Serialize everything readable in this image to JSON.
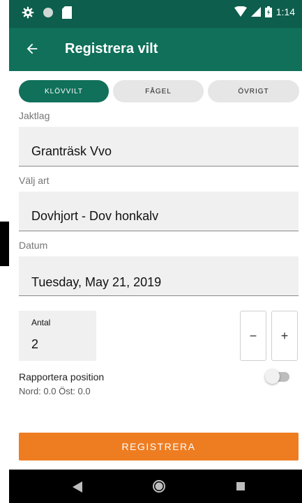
{
  "status_bar": {
    "time": "1:14"
  },
  "app_bar": {
    "title": "Registrera vilt"
  },
  "segments": [
    {
      "label": "KLÖVVILT",
      "active": true
    },
    {
      "label": "FÅGEL",
      "active": false
    },
    {
      "label": "ÖVRIGT",
      "active": false
    }
  ],
  "form": {
    "jaktlag": {
      "label": "Jaktlag",
      "value": "Granträsk Vvo"
    },
    "art": {
      "label": "Välj art",
      "value": "Dovhjort - Dov honkalv"
    },
    "datum": {
      "label": "Datum",
      "value": "Tuesday, May 21, 2019"
    },
    "antal": {
      "label": "Antal",
      "value": "2"
    },
    "minus_label": "−",
    "plus_label": "+",
    "position": {
      "label": "Rapportera position",
      "coords": "Nord: 0.0 Öst: 0.0",
      "enabled": false
    }
  },
  "submit_label": "REGISTRERA",
  "colors": {
    "status_bar": "#0d5e4c",
    "app_bar": "#10705a",
    "accent": "#ee7d22"
  }
}
